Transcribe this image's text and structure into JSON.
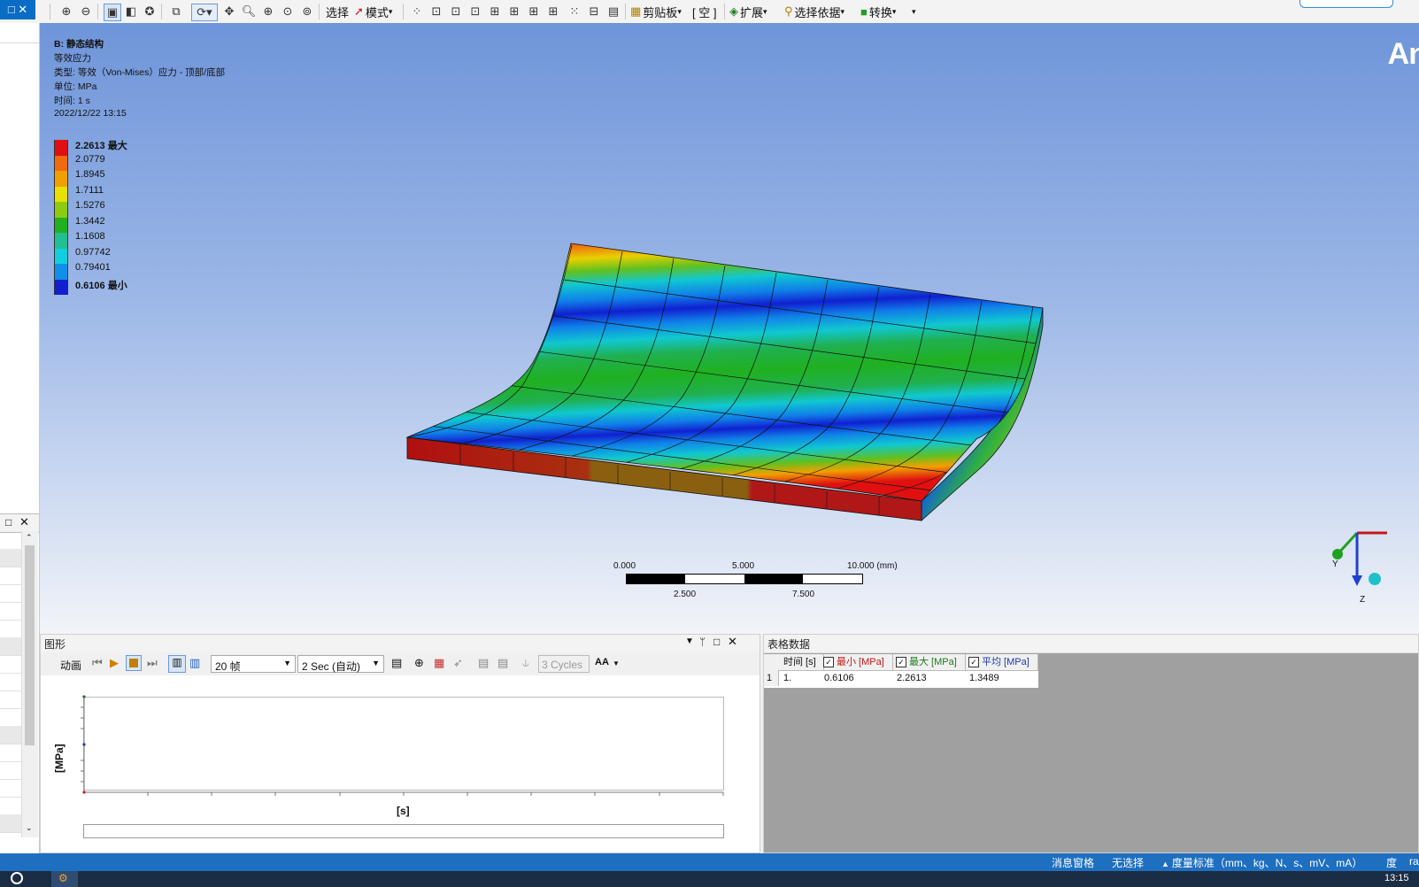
{
  "toolbar": {
    "select_label": "选择",
    "mode_label": "模式",
    "clipboard_label": "剪贴板",
    "empty_label": "[ 空 ]",
    "extend_label": "扩展",
    "select_by_label": "选择依据",
    "convert_label": "转换",
    "window_icon": "restore-icon"
  },
  "viewport": {
    "title": "B: 静态结构",
    "result_name": "等效应力",
    "type_line": "类型: 等效（Von-Mises）应力 - 顶部/底部",
    "unit_line": "单位: MPa",
    "time_line": "时间: 1 s",
    "date_line": "2022/12/22 13:15",
    "logo": "An",
    "legend": [
      {
        "label": "2.2613 最大",
        "color": "#e01010",
        "bold": true
      },
      {
        "label": "2.0779",
        "color": "#f06a10",
        "bold": false
      },
      {
        "label": "1.8945",
        "color": "#f0a000",
        "bold": false
      },
      {
        "label": "1.7111",
        "color": "#e8e000",
        "bold": false
      },
      {
        "label": "1.5276",
        "color": "#8ccc10",
        "bold": false
      },
      {
        "label": "1.3442",
        "color": "#20b020",
        "bold": false
      },
      {
        "label": "1.1608",
        "color": "#20c090",
        "bold": false
      },
      {
        "label": "0.97742",
        "color": "#10d0e0",
        "bold": false
      },
      {
        "label": "0.79401",
        "color": "#1090e8",
        "bold": false
      },
      {
        "label": "0.6106 最小",
        "color": "#1020d0",
        "bold": true
      }
    ],
    "scale": {
      "top_labels": [
        "0.000",
        "5.000",
        "10.000 (mm)"
      ],
      "bottom_labels": [
        "2.500",
        "7.500"
      ]
    },
    "axes": {
      "y": "Y",
      "z": "Z"
    }
  },
  "graph_panel": {
    "title": "图形",
    "animate_label": "动画",
    "frames": "20 帧",
    "duration": "2 Sec (自动)",
    "cycles": "3 Cycles",
    "font_label": "AA",
    "y_axis_label": "[MPa]",
    "x_axis_label": "[s]"
  },
  "table_panel": {
    "title": "表格数据",
    "columns": [
      "时间 [s]",
      "最小 [MPa]",
      "最大 [MPa]",
      "平均 [MPa]"
    ],
    "column_colors": [
      "#111111",
      "#c01818",
      "#1a7a1a",
      "#1a3aaa"
    ],
    "rows": [
      {
        "index": "1",
        "cells": [
          "1.",
          "0.6106",
          "2.2613",
          "1.3489"
        ]
      }
    ]
  },
  "status_bar": {
    "messages": "消息窗格",
    "selection": "无选择",
    "units": "度量标准（mm、kg、N、s、mV、mA）",
    "angle": "度",
    "extra": "ra"
  },
  "taskbar": {
    "clock": "13:15"
  }
}
